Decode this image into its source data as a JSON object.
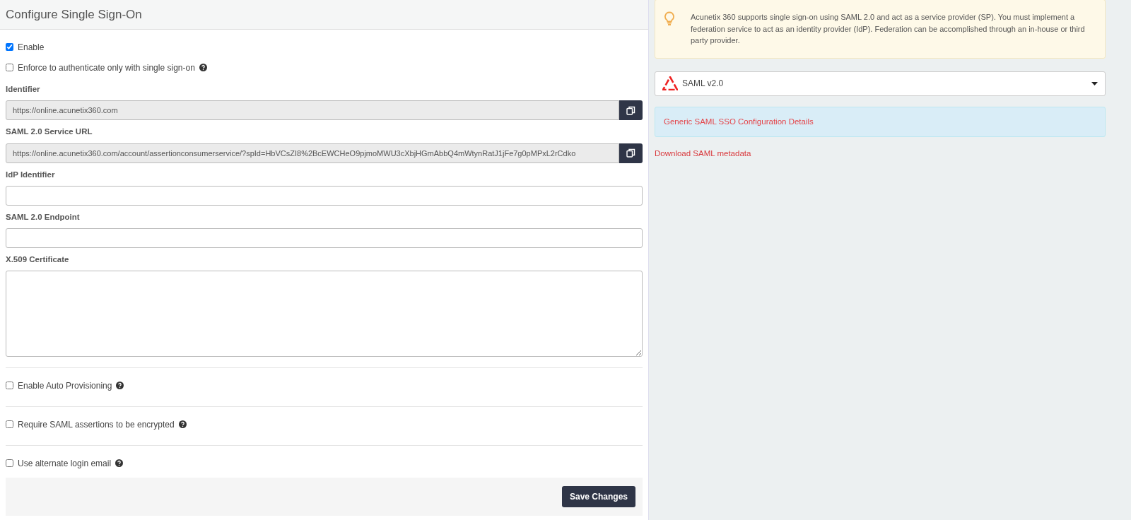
{
  "title": "Configure Single Sign-On",
  "items": [
    {
      "kind": "checkbox",
      "label": "Enable",
      "checked": true,
      "help": false
    },
    {
      "kind": "checkbox",
      "label": "Enforce to authenticate only with single sign-on",
      "checked": false,
      "help": true
    },
    {
      "kind": "text",
      "label": "Identifier",
      "value": "https://online.acunetix360.com",
      "readonly": true,
      "copy_button": true
    },
    {
      "kind": "text",
      "label": "SAML 2.0 Service URL",
      "value": "https://online.acunetix360.com/account/assertionconsumerservice/?spId=HbVCsZI8%2BcEWCHeO9pjmoMWU3cXbjHGmAbbQ4mWtynRatJ1jFe7g0pMPxL2rCdko",
      "readonly": true,
      "copy_button": true
    },
    {
      "kind": "text",
      "label": "IdP Identifier",
      "value": "",
      "readonly": false,
      "copy_button": false
    },
    {
      "kind": "text",
      "label": "SAML 2.0 Endpoint",
      "value": "",
      "readonly": false,
      "copy_button": false
    },
    {
      "kind": "textarea",
      "label": "X.509 Certificate",
      "value": ""
    },
    {
      "kind": "divider"
    },
    {
      "kind": "checkbox",
      "label": "Enable Auto Provisioning",
      "checked": false,
      "help": true
    },
    {
      "kind": "divider"
    },
    {
      "kind": "checkbox",
      "label": "Require SAML assertions to be encrypted",
      "checked": false,
      "help": true
    },
    {
      "kind": "divider"
    },
    {
      "kind": "checkbox",
      "label": "Use alternate login email",
      "checked": false,
      "help": true
    }
  ],
  "save_button": "Save Changes",
  "info": "Acunetix 360 supports single sign-on using SAML 2.0 and act as a service provider (SP). You must implement a federation service to act as an identity provider (IdP). Federation can be accomplished through an in-house or third party provider.",
  "provider_select": {
    "value": "SAML v2.0"
  },
  "config_panel": "Generic SAML SSO Configuration Details",
  "download_link": "Download SAML metadata"
}
